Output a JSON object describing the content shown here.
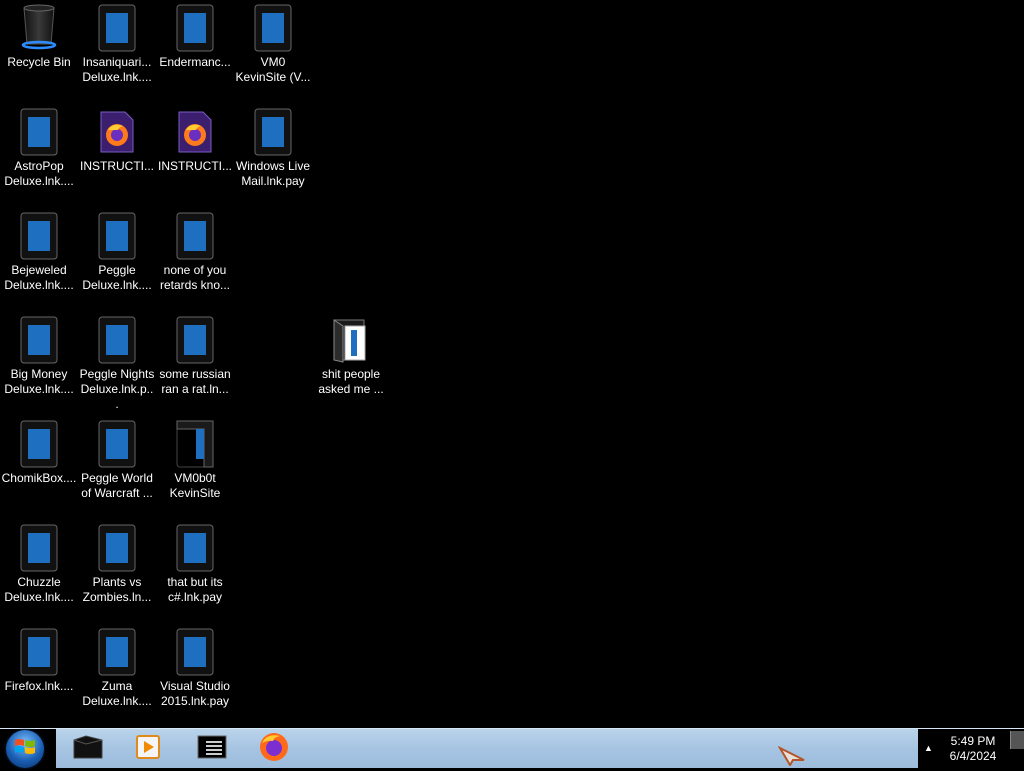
{
  "desktop": {
    "icons": [
      {
        "label": "Recycle Bin",
        "icon": "recycle-bin-icon"
      },
      {
        "label": "Insaniquari...\nDeluxe.lnk....",
        "icon": "shortcut-icon"
      },
      {
        "label": "Endermanc...",
        "icon": "shortcut-icon"
      },
      {
        "label": "VM0\nKevinSite (V...",
        "icon": "shortcut-icon"
      },
      {
        "label": "AstroPop\nDeluxe.lnk....",
        "icon": "shortcut-icon"
      },
      {
        "label": "INSTRUCTI...",
        "icon": "firefox-document-icon"
      },
      {
        "label": "INSTRUCTI...",
        "icon": "firefox-document-icon"
      },
      {
        "label": "Windows Live\nMail.lnk.pay",
        "icon": "shortcut-icon"
      },
      {
        "label": "Bejeweled\nDeluxe.lnk....",
        "icon": "shortcut-icon"
      },
      {
        "label": "Peggle\nDeluxe.lnk....",
        "icon": "shortcut-icon"
      },
      {
        "label": "none of you\nretards kno...",
        "icon": "shortcut-icon"
      },
      {
        "label": "Big Money\nDeluxe.lnk....",
        "icon": "shortcut-icon"
      },
      {
        "label": "Peggle Nights\nDeluxe.lnk.p...",
        "icon": "shortcut-icon"
      },
      {
        "label": "some russian\nran a rat.ln...",
        "icon": "shortcut-icon"
      },
      {
        "label": "shit people\nasked me ...",
        "icon": "folder-icon"
      },
      {
        "label": "ChomikBox....",
        "icon": "shortcut-icon"
      },
      {
        "label": "Peggle World\nof Warcraft ...",
        "icon": "shortcut-icon"
      },
      {
        "label": "VM0b0t\nKevinSite",
        "icon": "shortcut-partial-icon"
      },
      {
        "label": "Chuzzle\nDeluxe.lnk....",
        "icon": "shortcut-icon"
      },
      {
        "label": "Plants vs\nZombies.ln...",
        "icon": "shortcut-icon"
      },
      {
        "label": "that but its\nc#.lnk.pay",
        "icon": "shortcut-icon"
      },
      {
        "label": "Firefox.lnk....",
        "icon": "shortcut-icon"
      },
      {
        "label": "Zuma\nDeluxe.lnk....",
        "icon": "shortcut-icon"
      },
      {
        "label": "Visual Studio\n2015.lnk.pay",
        "icon": "shortcut-icon"
      }
    ]
  },
  "taskbar": {
    "start_icon": "windows-logo-icon",
    "pinned": [
      {
        "name": "explorer-icon"
      },
      {
        "name": "media-player-icon"
      },
      {
        "name": "command-prompt-icon"
      },
      {
        "name": "firefox-icon"
      }
    ],
    "tray_arrow": "▲",
    "clock": {
      "time": "5:49 PM",
      "date": "6/4/2024"
    }
  },
  "colors": {
    "desktop_bg": "#000000",
    "taskbar_bg": "#a6c4e2",
    "tile_blue": "#1e6fbf"
  }
}
